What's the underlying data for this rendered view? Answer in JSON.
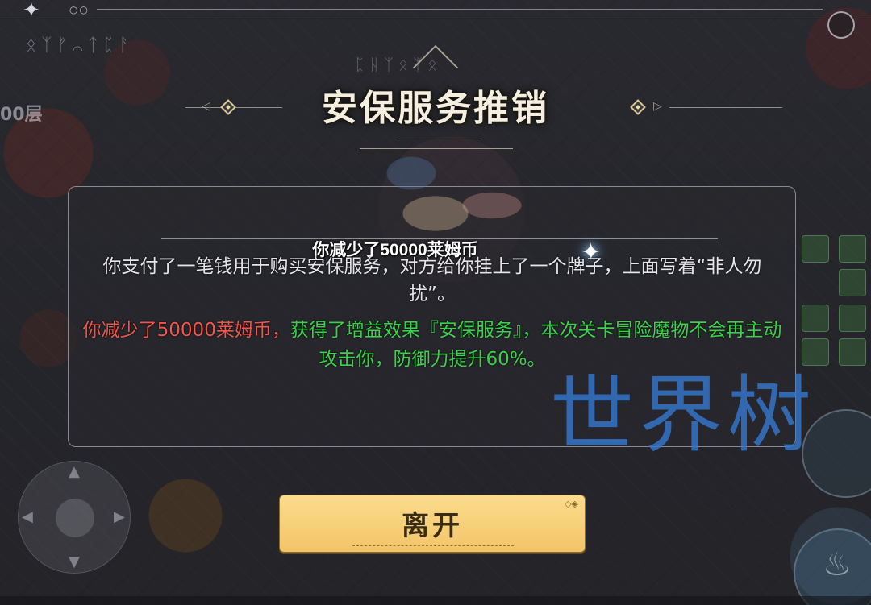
{
  "dialog": {
    "title": "安保服务推销",
    "toast": "你减少了50000莱姆币",
    "description": "你支付了一笔钱用于购买安保服务，对方给你挂上了一个牌子，上面写着“非人勿扰”。",
    "effect_cost": "你减少了50000莱姆币，",
    "effect_gain": "获得了增益效果『安保服务』，本次关卡冒险魔物不会再主动攻击你，防御力提升60%。",
    "leave_label": "离开"
  },
  "hud": {
    "floor_text": "00层",
    "runes_top": "ᛟᛉᚠ⌒ᛏᛈᚨ",
    "runes_title": "ᛈᚺᛉᛟᛉᛟ"
  },
  "watermark": "世界树",
  "colors": {
    "cost_red": "#f0564c",
    "gain_green": "#3bd24a",
    "button_gold": "#f3c468",
    "watermark_blue": "#3478cd"
  }
}
